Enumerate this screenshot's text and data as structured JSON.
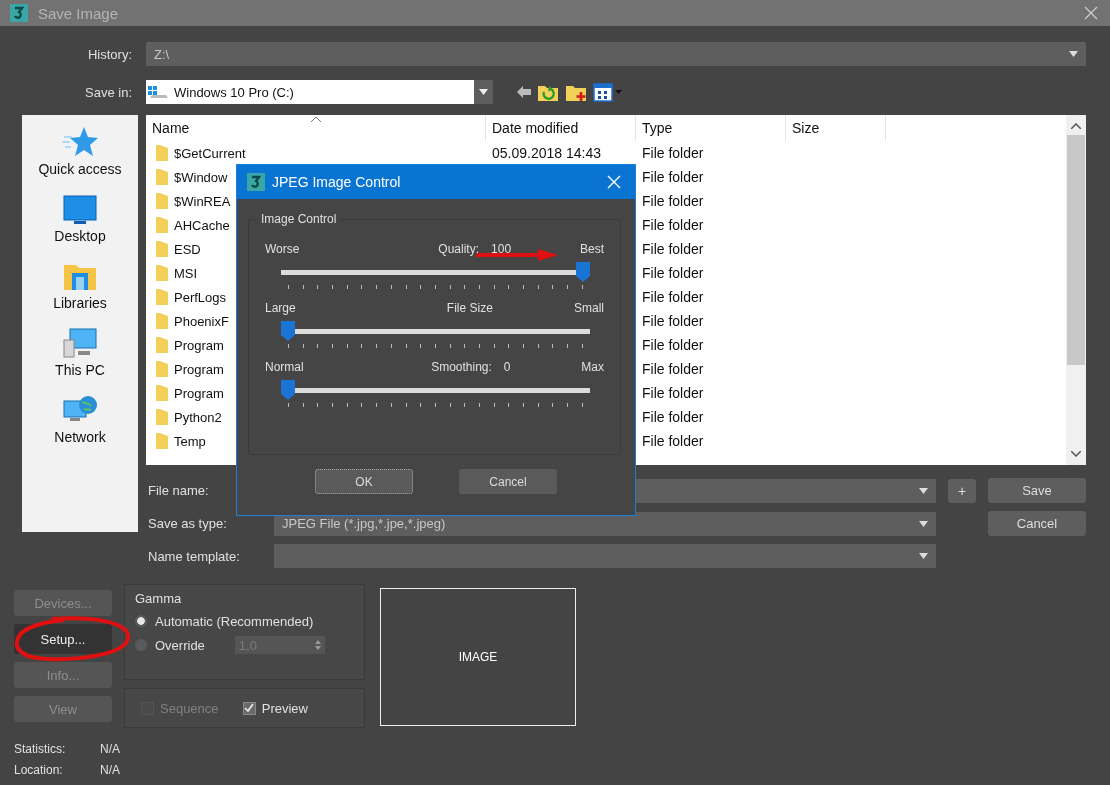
{
  "window": {
    "title": "Save Image"
  },
  "history": {
    "label": "History:",
    "value": "Z:\\"
  },
  "save_in": {
    "label": "Save in:",
    "value": "Windows 10 Pro (C:)"
  },
  "places": [
    {
      "label": "Quick access",
      "kind": "star"
    },
    {
      "label": "Desktop",
      "kind": "desktop"
    },
    {
      "label": "Libraries",
      "kind": "library"
    },
    {
      "label": "This PC",
      "kind": "pc"
    },
    {
      "label": "Network",
      "kind": "network"
    }
  ],
  "file_list": {
    "columns": [
      "Name",
      "Date modified",
      "Type",
      "Size"
    ],
    "rows": [
      {
        "name": "$GetCurrent",
        "date": "05.09.2018 14:43",
        "type": "File folder"
      },
      {
        "name": "$Window",
        "type": "File folder"
      },
      {
        "name": "$WinREA",
        "type": "File folder"
      },
      {
        "name": "AHCache",
        "type": "File folder"
      },
      {
        "name": "ESD",
        "type": "File folder"
      },
      {
        "name": "MSI",
        "type": "File folder"
      },
      {
        "name": "PerfLogs",
        "type": "File folder"
      },
      {
        "name": "PhoenixF",
        "type": "File folder"
      },
      {
        "name": "Program",
        "type": "File folder"
      },
      {
        "name": "Program",
        "type": "File folder"
      },
      {
        "name": "Program",
        "type": "File folder"
      },
      {
        "name": "Python2",
        "type": "File folder"
      },
      {
        "name": "Temp",
        "type": "File folder"
      }
    ]
  },
  "file_name": {
    "label": "File name:"
  },
  "save_as_type": {
    "label": "Save as type:",
    "value": "JPEG File (*.jpg,*.jpe,*.jpeg)"
  },
  "name_template": {
    "label": "Name template:"
  },
  "actions": {
    "add": "+",
    "save": "Save",
    "cancel": "Cancel"
  },
  "side_buttons": [
    {
      "label": "Devices...",
      "disabled": true
    },
    {
      "label": "Setup...",
      "disabled": false
    },
    {
      "label": "Info...",
      "disabled": true
    },
    {
      "label": "View",
      "disabled": true
    }
  ],
  "gamma": {
    "title": "Gamma",
    "options": [
      {
        "label": "Automatic (Recommended)",
        "selected": true
      },
      {
        "label": "Override",
        "selected": false
      }
    ],
    "override_field": {
      "value": "1,0",
      "disabled": true
    }
  },
  "sequence": {
    "label": "Sequence",
    "checked": false,
    "disabled": true
  },
  "preview": {
    "label": "Preview",
    "checked": true,
    "disabled": false
  },
  "preview_box": {
    "label": "IMAGE"
  },
  "info": [
    {
      "label": "Statistics:",
      "value": "N/A"
    },
    {
      "label": "Location:",
      "value": "N/A"
    }
  ],
  "jpeg_dialog": {
    "title": "JPEG Image Control",
    "group": "Image Control",
    "sliders": [
      {
        "left": "Worse",
        "center": "Quality:",
        "value": "100",
        "right": "Best",
        "level": 1
      },
      {
        "left": "Large",
        "center": "File Size",
        "right": "Small",
        "level": 0
      },
      {
        "left": "Normal",
        "center": "Smoothing:",
        "value": "0",
        "right": "Max",
        "level": 0
      }
    ],
    "buttons": [
      {
        "label": "OK",
        "focused": true
      },
      {
        "label": "Cancel",
        "focused": false
      }
    ]
  }
}
